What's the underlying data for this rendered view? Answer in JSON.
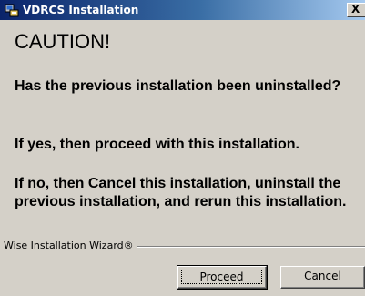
{
  "window": {
    "title": "VDRCS Installation",
    "close_glyph": "X"
  },
  "content": {
    "heading": "CAUTION!",
    "paragraph_1": "Has the previous installation been uninstalled?",
    "paragraph_2": "If yes, then proceed with this installation.",
    "paragraph_3": "If no, then Cancel this installation, uninstall the previous installation, and rerun this installation."
  },
  "footer": {
    "label": "Wise Installation Wizard®"
  },
  "buttons": {
    "proceed_label": "Proceed",
    "cancel_label": "Cancel"
  },
  "icons": {
    "app": "installer-app-icon",
    "close": "close-icon"
  },
  "colors": {
    "titlebar_start": "#0a246a",
    "titlebar_end": "#a6caf0",
    "dialog_face": "#d4d0c8"
  }
}
